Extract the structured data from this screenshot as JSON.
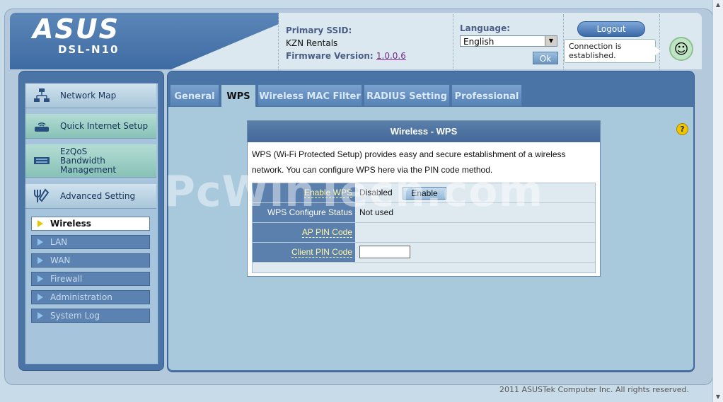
{
  "header": {
    "brand": "ASUS",
    "model": "DSL-N10",
    "primary_ssid_label": "Primary SSID:",
    "primary_ssid_value": "KZN Rentals",
    "firmware_label": "Firmware Version:",
    "firmware_value": "1.0.0.6",
    "language_label": "Language:",
    "language_value": "English",
    "ok_label": "Ok",
    "logout_label": "Logout",
    "connection_status": "Connection is established."
  },
  "sidebar": {
    "main_items": [
      {
        "label": "Network Map",
        "icon": "network-map-icon"
      },
      {
        "label": "Quick Internet Setup",
        "icon": "router-icon"
      },
      {
        "label": "EzQoS Bandwidth Management",
        "icon": "bandwidth-icon"
      },
      {
        "label": "Advanced Setting",
        "icon": "tools-icon"
      }
    ],
    "sub_items": [
      {
        "label": "Wireless",
        "active": true
      },
      {
        "label": "LAN",
        "active": false
      },
      {
        "label": "WAN",
        "active": false
      },
      {
        "label": "Firewall",
        "active": false
      },
      {
        "label": "Administration",
        "active": false
      },
      {
        "label": "System Log",
        "active": false
      }
    ]
  },
  "tabs": [
    {
      "label": "General",
      "active": false
    },
    {
      "label": "WPS",
      "active": true
    },
    {
      "label": "Wireless MAC Filter",
      "active": false
    },
    {
      "label": "RADIUS Setting",
      "active": false
    },
    {
      "label": "Professional",
      "active": false
    }
  ],
  "wps": {
    "title": "Wireless - WPS",
    "description": "WPS (Wi-Fi Protected Setup) provides easy and secure establishment of a wireless network. You can configure WPS here via the PIN code method.",
    "enable_label": "Enable WPS",
    "enable_value": "Disabled",
    "enable_button": "Enable",
    "status_label": "WPS Configure Status",
    "status_value": "Not used",
    "ap_pin_label": "AP PIN Code",
    "ap_pin_value": "",
    "client_pin_label": "Client PIN Code",
    "client_pin_value": ""
  },
  "footer": "2011 ASUSTek Computer Inc. All rights reserved.",
  "watermark": "PcWinTech.com",
  "colors": {
    "accent": "#4a74a6",
    "link": "#fff6a0"
  }
}
